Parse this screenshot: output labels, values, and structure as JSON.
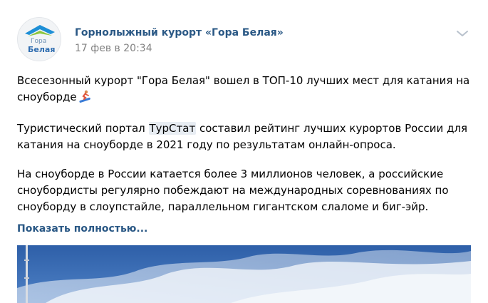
{
  "post": {
    "author": "Горнолыжный курорт «Гора Белая»",
    "date": "17 фев в 20:34",
    "avatar": {
      "logo_word1": "Гора",
      "logo_word2": "Белая",
      "brand_color": "#2f6db0"
    },
    "text": {
      "p1_line1": "Всесезонный курорт \"Гора Белая\" вошел в ТОП-10 лучших мест для катания на",
      "p1_line2": "сноуборде",
      "p2_line1_before": "Туристический портал ",
      "p2_mention": "ТурСтат",
      "p2_line1_after": " составил рейтинг лучших курортов России для",
      "p2_line2": "катания на сноуборде в 2021 году по результатам онлайн-опроса.",
      "p3_line1": "На сноуборде в России катается более 3 миллионов человек, а российские",
      "p3_line2": "сноубордисты регулярно побеждают на международных соревнованиях по",
      "p3_line3": "сноуборду в слоупстайле, параллельном гигантском слаломе и биг-эйр."
    },
    "show_more": "Показать полностью...",
    "icons": {
      "menu": "chevron-down-icon",
      "emoji": "snowboarder-icon"
    },
    "colors": {
      "link": "#2a5885",
      "date": "#828282",
      "mention_bg": "#e8edf3",
      "sky": "#3f6fb5"
    }
  }
}
